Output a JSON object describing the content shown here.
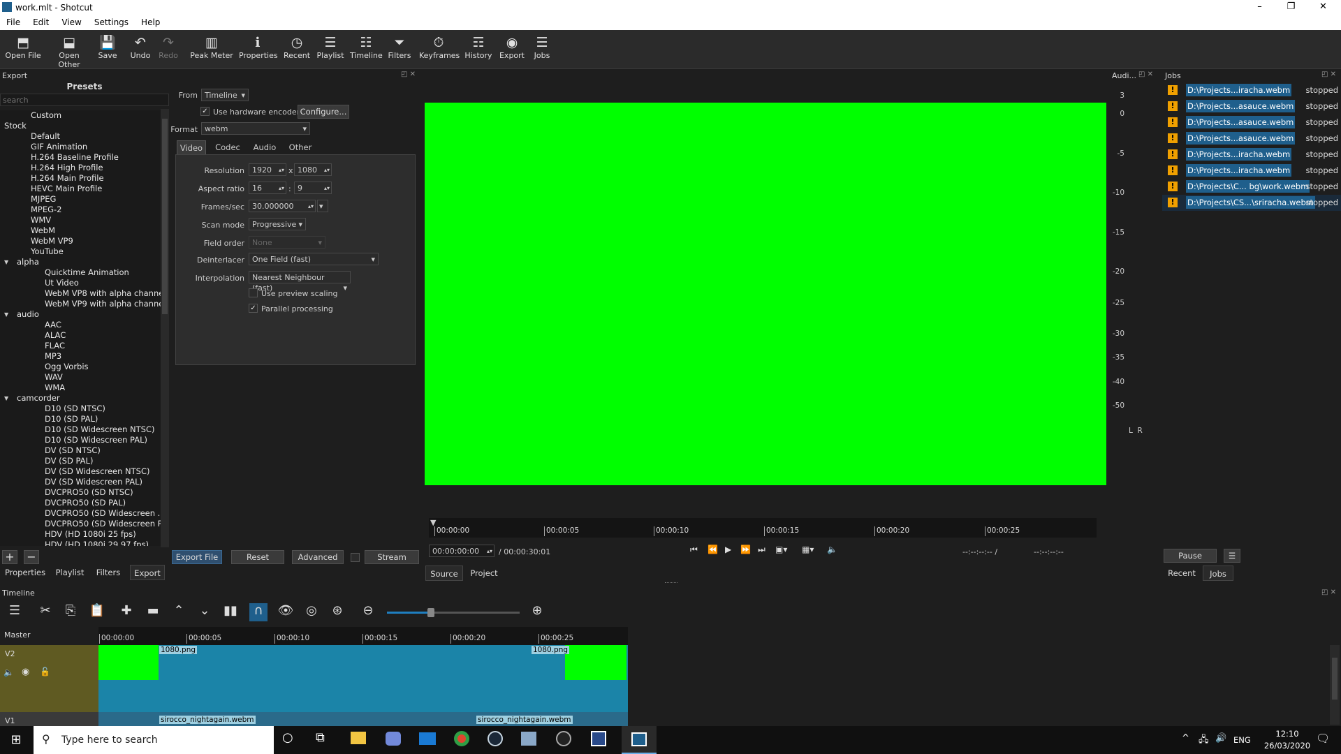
{
  "window": {
    "title": "work.mlt - Shotcut",
    "minimize": "–",
    "restore": "❐",
    "close": "✕"
  },
  "menu": [
    "File",
    "Edit",
    "View",
    "Settings",
    "Help"
  ],
  "toolbar": [
    {
      "label": "Open File",
      "icon": "⬒"
    },
    {
      "label": "Open Other",
      "icon": "⬓"
    },
    {
      "label": "Save",
      "icon": "💾"
    },
    {
      "label": "Undo",
      "icon": "↶"
    },
    {
      "label": "Redo",
      "icon": "↷"
    },
    {
      "label": "Peak Meter",
      "icon": "▥"
    },
    {
      "label": "Properties",
      "icon": "ℹ"
    },
    {
      "label": "Recent",
      "icon": "◷"
    },
    {
      "label": "Playlist",
      "icon": "☰"
    },
    {
      "label": "Timeline",
      "icon": "☷"
    },
    {
      "label": "Filters",
      "icon": "⏷"
    },
    {
      "label": "Keyframes",
      "icon": "⏱"
    },
    {
      "label": "History",
      "icon": "☶"
    },
    {
      "label": "Export",
      "icon": "◉"
    },
    {
      "label": "Jobs",
      "icon": "☰"
    }
  ],
  "export_panel": {
    "header": "Export",
    "presets_title": "Presets",
    "search_placeholder": "search",
    "presets": [
      {
        "label": "Custom",
        "level": 1
      },
      {
        "label": "Stock",
        "level": 0,
        "expander": "▼"
      },
      {
        "label": "Default",
        "level": 1
      },
      {
        "label": "GIF Animation",
        "level": 1
      },
      {
        "label": "H.264 Baseline Profile",
        "level": 1
      },
      {
        "label": "H.264 High Profile",
        "level": 1
      },
      {
        "label": "H.264 Main Profile",
        "level": 1
      },
      {
        "label": "HEVC Main Profile",
        "level": 1
      },
      {
        "label": "MJPEG",
        "level": 1
      },
      {
        "label": "MPEG-2",
        "level": 1
      },
      {
        "label": "WMV",
        "level": 1
      },
      {
        "label": "WebM",
        "level": 1
      },
      {
        "label": "WebM VP9",
        "level": 1
      },
      {
        "label": "YouTube",
        "level": 1
      },
      {
        "label": "alpha",
        "level": 2,
        "expander": "▼"
      },
      {
        "label": "Quicktime Animation",
        "level": 3
      },
      {
        "label": "Ut Video",
        "level": 3
      },
      {
        "label": "WebM VP8 with alpha channel",
        "level": 3
      },
      {
        "label": "WebM VP9 with alpha channel",
        "level": 3
      },
      {
        "label": "audio",
        "level": 2,
        "expander": "▼"
      },
      {
        "label": "AAC",
        "level": 3
      },
      {
        "label": "ALAC",
        "level": 3
      },
      {
        "label": "FLAC",
        "level": 3
      },
      {
        "label": "MP3",
        "level": 3
      },
      {
        "label": "Ogg Vorbis",
        "level": 3
      },
      {
        "label": "WAV",
        "level": 3
      },
      {
        "label": "WMA",
        "level": 3
      },
      {
        "label": "camcorder",
        "level": 2,
        "expander": "▼"
      },
      {
        "label": "D10 (SD NTSC)",
        "level": 3
      },
      {
        "label": "D10 (SD PAL)",
        "level": 3
      },
      {
        "label": "D10 (SD Widescreen NTSC)",
        "level": 3
      },
      {
        "label": "D10 (SD Widescreen PAL)",
        "level": 3
      },
      {
        "label": "DV (SD NTSC)",
        "level": 3
      },
      {
        "label": "DV (SD PAL)",
        "level": 3
      },
      {
        "label": "DV (SD Widescreen NTSC)",
        "level": 3
      },
      {
        "label": "DV (SD Widescreen PAL)",
        "level": 3
      },
      {
        "label": "DVCPRO50 (SD NTSC)",
        "level": 3
      },
      {
        "label": "DVCPRO50 (SD PAL)",
        "level": 3
      },
      {
        "label": "DVCPRO50 (SD Widescreen ...",
        "level": 3
      },
      {
        "label": "DVCPRO50 (SD Widescreen P...",
        "level": 3
      },
      {
        "label": "HDV (HD 1080i 25 fps)",
        "level": 3
      },
      {
        "label": "HDV (HD 1080i 29.97 fps)",
        "level": 3
      }
    ],
    "from_label": "From",
    "from_value": "Timeline",
    "hw_encoder_label": "Use hardware encoder",
    "configure_button": "Configure...",
    "format_label": "Format",
    "format_value": "webm",
    "tabs": [
      "Video",
      "Codec",
      "Audio",
      "Other"
    ],
    "resolution_label": "Resolution",
    "res_w": "1920",
    "res_x": "x",
    "res_h": "1080",
    "aspect_label": "Aspect ratio",
    "aspect_w": "16",
    "aspect_sep": ":",
    "aspect_h": "9",
    "fps_label": "Frames/sec",
    "fps_value": "30.000000",
    "scan_label": "Scan mode",
    "scan_value": "Progressive",
    "field_order_label": "Field order",
    "field_order_value": "None",
    "deinterlacer_label": "Deinterlacer",
    "deinterlacer_value": "One Field (fast)",
    "interpolation_label": "Interpolation",
    "interpolation_value": "Nearest Neighbour (fast)",
    "preview_scaling_label": "Use preview scaling",
    "parallel_label": "Parallel processing",
    "add_button": "+",
    "remove_button": "−",
    "export_file_button": "Export File",
    "reset_button": "Reset",
    "advanced_button": "Advanced",
    "stream_button": "Stream",
    "bottom_tabs": [
      "Properties",
      "Playlist",
      "Filters",
      "Export"
    ]
  },
  "player": {
    "ruler_labels": [
      "00:00:00",
      "00:00:05",
      "00:00:10",
      "00:00:15",
      "00:00:20",
      "00:00:25"
    ],
    "current_time": "00:00:00:00",
    "duration": "/ 00:00:30:01",
    "in_point": "--:--:--:-- /",
    "out_point": "--:--:--:--",
    "source_tab": "Source",
    "project_tab": "Project",
    "frame_color": "#00ff00"
  },
  "audio_meter": {
    "title": "Audi...",
    "scale": [
      "3",
      "0",
      "-5",
      "-10",
      "-15",
      "-20",
      "-25",
      "-30",
      "-35",
      "-40",
      "-50"
    ],
    "channels": "L  R"
  },
  "jobs": {
    "title": "Jobs",
    "items": [
      {
        "name": "D:\\Projects...iracha.webm",
        "status": "stopped"
      },
      {
        "name": "D:\\Projects...asauce.webm",
        "status": "stopped"
      },
      {
        "name": "D:\\Projects...asauce.webm",
        "status": "stopped"
      },
      {
        "name": "D:\\Projects...asauce.webm",
        "status": "stopped"
      },
      {
        "name": "D:\\Projects...iracha.webm",
        "status": "stopped"
      },
      {
        "name": "D:\\Projects...iracha.webm",
        "status": "stopped"
      },
      {
        "name": "D:\\Projects\\C... bg\\work.webm",
        "status": "stopped"
      },
      {
        "name": "D:\\Projects\\CS...\\sriracha.webm",
        "status": "stopped"
      }
    ],
    "pause_button": "Pause",
    "menu_button": "☰",
    "recent_tab": "Recent",
    "jobs_tab": "Jobs"
  },
  "timeline": {
    "title": "Timeline",
    "master_label": "Master",
    "ruler_labels": [
      "00:00:00",
      "00:00:05",
      "00:00:10",
      "00:00:15",
      "00:00:20",
      "00:00:25"
    ],
    "tracks": [
      {
        "name": "V2",
        "clips": [
          "1080.png",
          "1080.png"
        ]
      },
      {
        "name": "V1",
        "clips": [
          "sirocco_nightagain.webm",
          "sirocco_nightagain.webm"
        ]
      }
    ]
  },
  "taskbar": {
    "search_placeholder": "Type here to search",
    "language": "ENG",
    "time": "12:10",
    "date": "26/03/2020"
  }
}
